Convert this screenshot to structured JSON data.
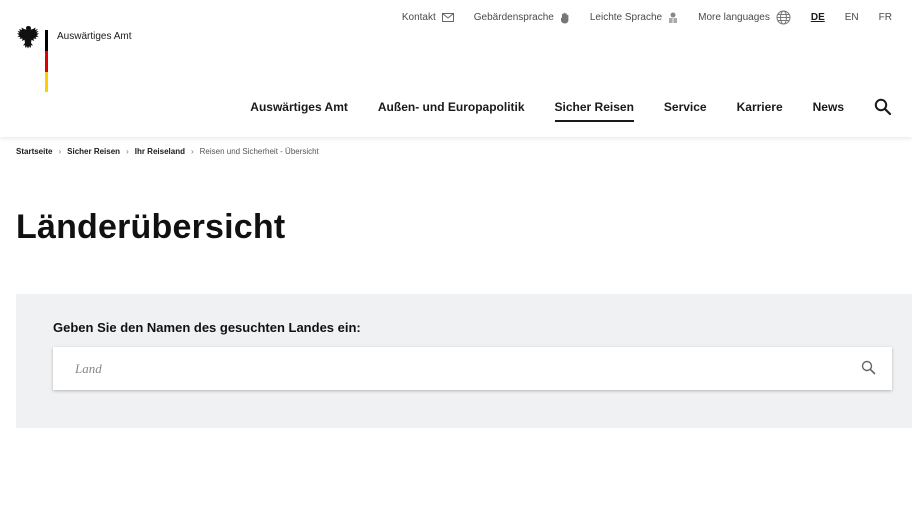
{
  "header": {
    "logo_text": "Auswärtiges Amt",
    "meta_links": [
      {
        "label": "Kontakt",
        "icon": "mail-icon"
      },
      {
        "label": "Gebärdensprache",
        "icon": "hand-icon"
      },
      {
        "label": "Leichte Sprache",
        "icon": "easy-language-icon"
      },
      {
        "label": "More languages",
        "icon": "globe-icon"
      }
    ],
    "languages": [
      "DE",
      "EN",
      "FR"
    ],
    "active_language": "DE",
    "nav": [
      "Auswärtiges Amt",
      "Außen- und Europapolitik",
      "Sicher Reisen",
      "Service",
      "Karriere",
      "News"
    ],
    "active_nav": "Sicher Reisen"
  },
  "breadcrumb": {
    "items": [
      "Startseite",
      "Sicher Reisen",
      "Ihr Reiseland"
    ],
    "current": "Reisen und Sicherheit - Übersicht"
  },
  "page": {
    "title": "Länderübersicht"
  },
  "search": {
    "label": "Geben Sie den Namen des gesuchten Landes ein:",
    "placeholder": "Land",
    "value": ""
  },
  "colors": {
    "flag_black": "#000000",
    "flag_red": "#dd0000",
    "flag_gold": "#ffce00",
    "panel_bg": "#f0f1f2"
  }
}
